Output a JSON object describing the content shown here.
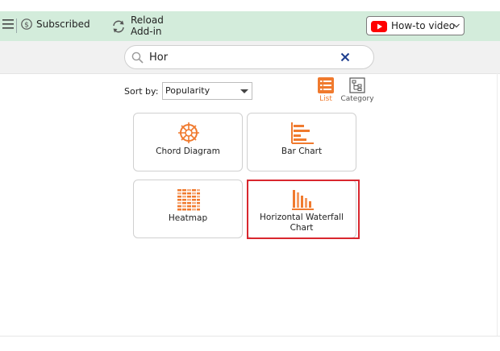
{
  "toolbar": {
    "subscribed_label": "Subscribed",
    "reload_line1": "Reload",
    "reload_line2": "Add-in",
    "howto_label": "How-to video"
  },
  "search": {
    "value": "Hor",
    "placeholder": ""
  },
  "sort": {
    "label": "Sort by:",
    "selected": "Popularity"
  },
  "view": {
    "list_label": "List",
    "category_label": "Category",
    "active": "List"
  },
  "cards": [
    {
      "label": "Chord Diagram",
      "icon": "chord-diagram-icon"
    },
    {
      "label": "Bar Chart",
      "icon": "bar-chart-icon"
    },
    {
      "label": "Heatmap",
      "icon": "heatmap-icon"
    },
    {
      "label": "Horizontal Waterfall Chart",
      "icon": "horizontal-waterfall-icon",
      "highlighted": true
    }
  ],
  "colors": {
    "toolbar_bg": "#d3ecdb",
    "accent_orange": "#f07a2e",
    "highlight_red": "#d9272e",
    "youtube_red": "#ff0000"
  }
}
